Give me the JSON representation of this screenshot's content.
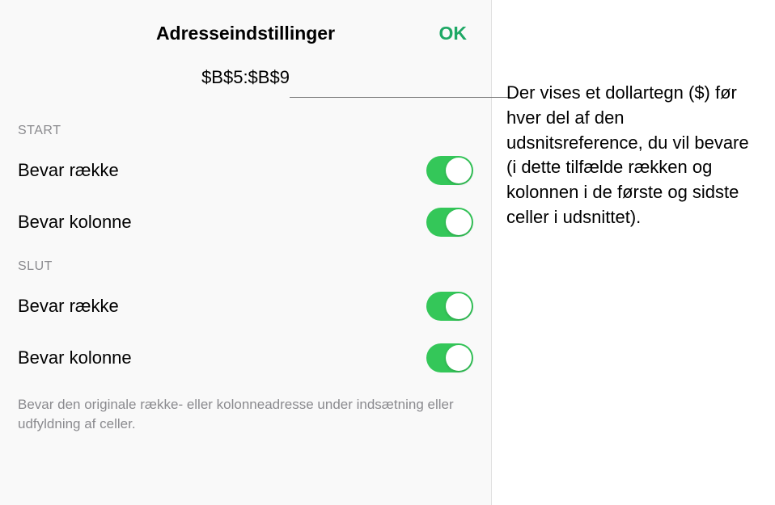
{
  "header": {
    "title": "Adresseindstillinger",
    "ok_label": "OK"
  },
  "reference": "$B$5:$B$9",
  "sections": {
    "start": {
      "label": "START",
      "row_toggle_label": "Bevar række",
      "column_toggle_label": "Bevar kolonne"
    },
    "end": {
      "label": "SLUT",
      "row_toggle_label": "Bevar række",
      "column_toggle_label": "Bevar kolonne"
    }
  },
  "footer": "Bevar den originale række- eller kolonneadresse under indsætning eller udfyldning af celler.",
  "annotation": "Der vises et dollartegn ($) før hver del af den udsnitsreference, du vil bevare (i dette tilfælde rækken og kolonnen i de første og sidste celler i udsnittet)."
}
